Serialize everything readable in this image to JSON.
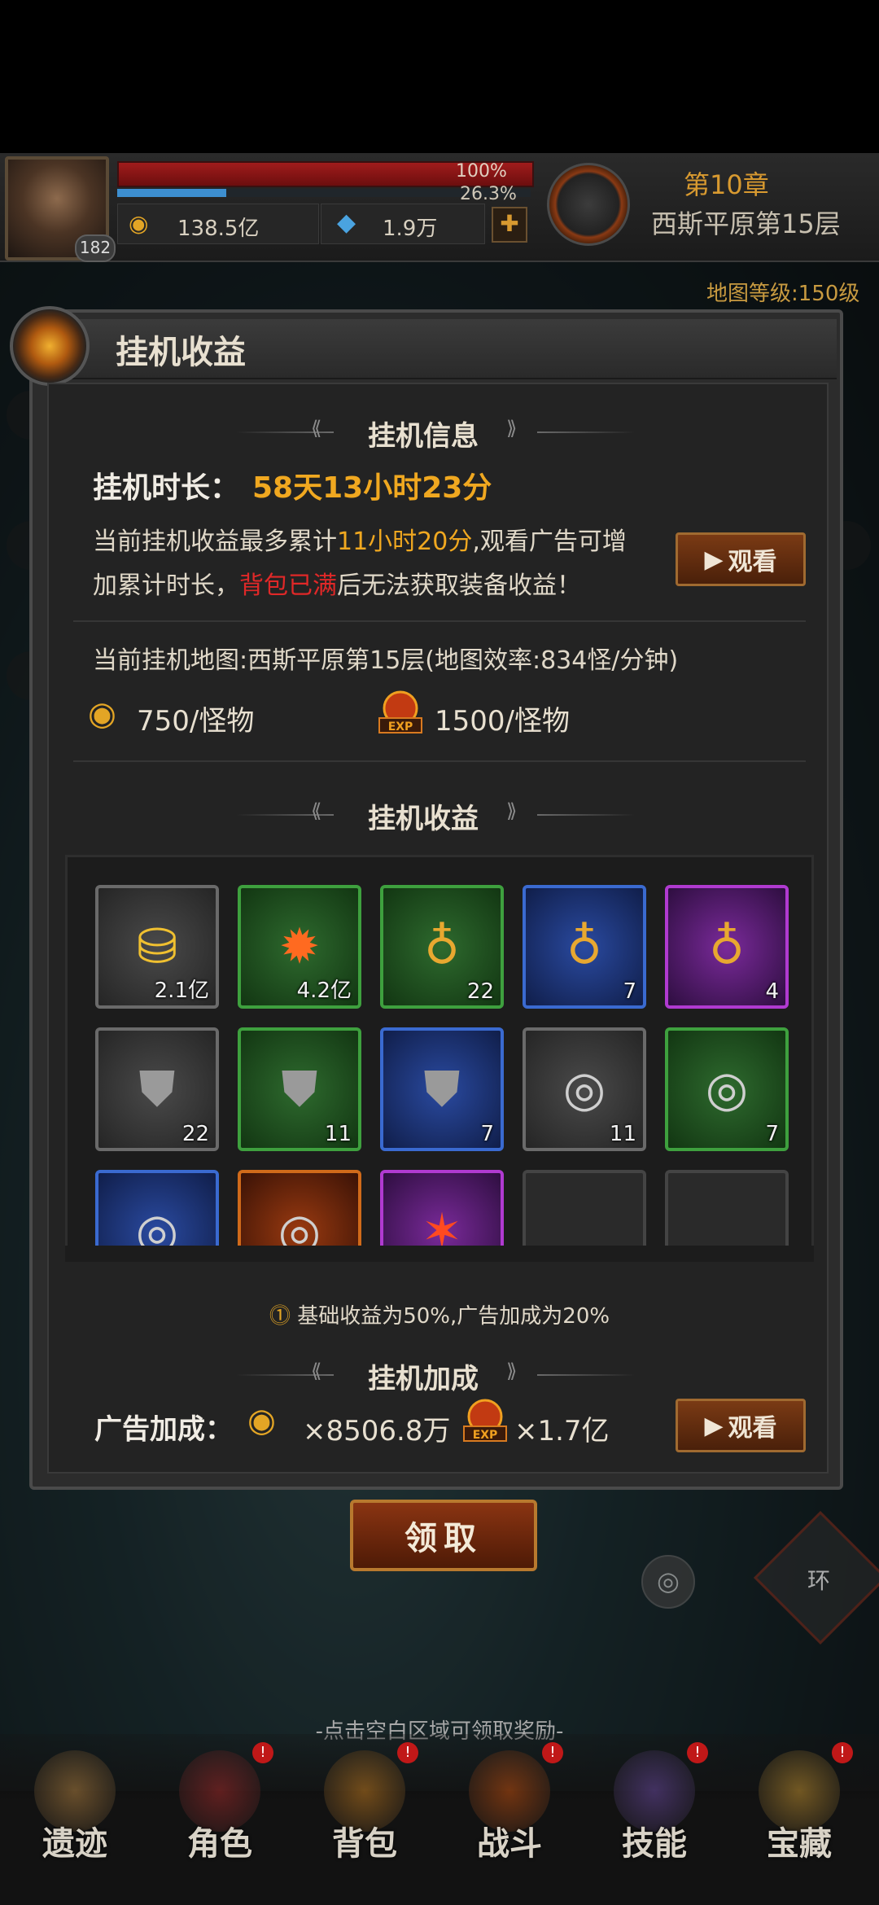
{
  "player": {
    "level": "182",
    "hp_percent": "100%",
    "xp_percent": "26.3%",
    "xp_fraction": 0.263,
    "gold": "138.5亿",
    "gems": "1.9万"
  },
  "chapter": {
    "title": "第10章",
    "subtitle": "西斯平原第15层",
    "map_level": "地图等级:150级"
  },
  "panel": {
    "title": "挂机收益",
    "info_section": "挂机信息",
    "duration_label": "挂机时长：",
    "duration_value": "58天13小时23分",
    "desc_a": "当前挂机收益最多累计",
    "desc_hours": "11小时20分",
    "desc_b": ",观看广告可增",
    "desc_c": "加累计时长，",
    "desc_full": "背包已满",
    "desc_d": "后无法获取装备收益！",
    "watch_label": "观看",
    "map_line": "当前挂机地图:西斯平原第15层(地图效率:834怪/分钟)",
    "gold_rate": "750/怪物",
    "exp_rate": "1500/怪物",
    "rewards_section": "挂机收益",
    "note": "基础收益为50%,广告加成为20%",
    "bonus_section": "挂机加成",
    "bonus_label": "广告加成：",
    "bonus_gold": "×8506.8万",
    "bonus_exp": "×1.7亿",
    "claim_label": "领取",
    "exp_badge": "EXP"
  },
  "rewards": [
    {
      "name": "gold-pile",
      "quality": "grey",
      "qty": "2.1亿",
      "icon": "gold-pile-icon"
    },
    {
      "name": "exp-orb",
      "quality": "green",
      "qty": "4.2亿",
      "icon": "exp-icon"
    },
    {
      "name": "loot-bag-green",
      "quality": "green",
      "qty": "22",
      "icon": "loot-bag-icon"
    },
    {
      "name": "loot-bag-blue",
      "quality": "blue",
      "qty": "7",
      "icon": "loot-bag-icon"
    },
    {
      "name": "loot-bag-purple",
      "quality": "purple",
      "qty": "4",
      "icon": "loot-bag-icon"
    },
    {
      "name": "armor-grey",
      "quality": "grey",
      "qty": "22",
      "icon": "armor-icon"
    },
    {
      "name": "armor-green",
      "quality": "green",
      "qty": "11",
      "icon": "armor-icon"
    },
    {
      "name": "armor-blue",
      "quality": "blue",
      "qty": "7",
      "icon": "armor-icon"
    },
    {
      "name": "ring-grey",
      "quality": "grey",
      "qty": "11",
      "icon": "ring-icon"
    },
    {
      "name": "ring-green",
      "quality": "green",
      "qty": "7",
      "icon": "ring-icon"
    },
    {
      "name": "ring-blue",
      "quality": "blue",
      "qty": "",
      "icon": "ring-icon"
    },
    {
      "name": "ring-orange",
      "quality": "orange",
      "qty": "",
      "icon": "ring-icon"
    },
    {
      "name": "scroll-purple",
      "quality": "purple",
      "qty": "",
      "icon": "scroll-icon"
    },
    {
      "name": "empty-slot",
      "quality": "empty",
      "qty": "",
      "icon": ""
    },
    {
      "name": "empty-slot",
      "quality": "empty",
      "qty": "",
      "icon": ""
    }
  ],
  "misc": {
    "loop_label": "环",
    "hint": "-点击空白区域可领取奖励-"
  },
  "nav": [
    {
      "label": "遗迹",
      "badge": ""
    },
    {
      "label": "角色",
      "badge": "!"
    },
    {
      "label": "背包",
      "badge": "!"
    },
    {
      "label": "战斗",
      "badge": "!"
    },
    {
      "label": "技能",
      "badge": "!"
    },
    {
      "label": "宝藏",
      "badge": "!"
    }
  ],
  "colors": {
    "accent": "#f0a820",
    "warning": "#e02828",
    "hp": "#a01c1c",
    "xp": "#3d8fd0"
  }
}
